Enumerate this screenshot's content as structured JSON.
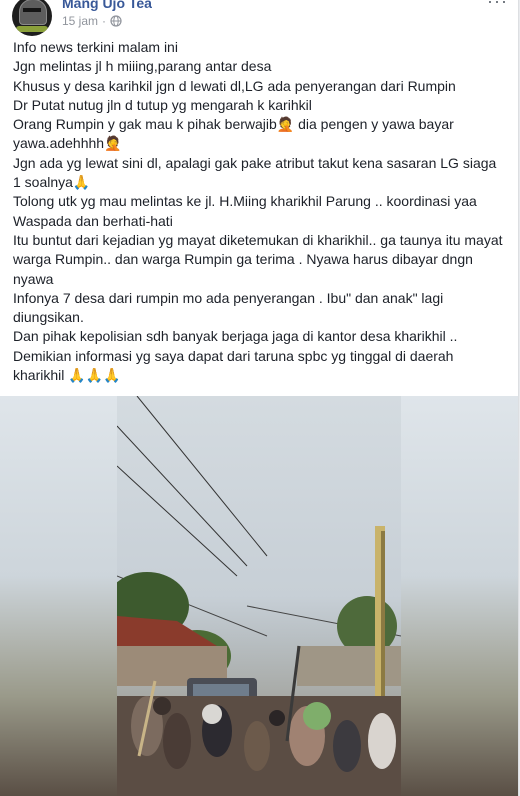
{
  "post": {
    "author": "Mang Ujo Tea",
    "time": "15 jam",
    "separator": "·",
    "privacy_icon": "globe-icon",
    "more_icon": "more-options-icon",
    "more_label": "···",
    "lines": [
      "Info news terkini malam ini",
      "Jgn melintas jl h miiing,parang antar desa",
      "Khusus y desa karihkil jgn d lewati dl,LG ada penyerangan dari Rumpin",
      "Dr Putat nutug jln d tutup yg mengarah k karihkil",
      "Orang Rumpin y gak mau k pihak berwajib🤦 dia pengen y yawa bayar",
      "yawa.adehhhh🤦",
      "Jgn ada yg lewat sini dl, apalagi gak pake atribut takut kena sasaran LG siaga",
      "1 soalnya🙏",
      "Tolong utk yg mau melintas ke jl. H.Miing kharikhil Parung .. koordinasi yaa",
      "Waspada dan berhati-hati",
      "Itu buntut dari kejadian yg mayat diketemukan di kharikhil.. ga taunya itu mayat",
      "warga Rumpin.. dan warga Rumpin ga terima . Nyawa harus dibayar dngn",
      "nyawa",
      "Infonya 7 desa dari rumpin mo ada penyerangan . Ibu\" dan anak\" lagi",
      "diungsikan.",
      "Dan pihak kepolisian sdh banyak berjaga jaga di kantor desa kharikhil ..",
      "Demikian informasi yg saya dapat dari taruna spbc yg tinggal di daerah",
      "kharikhil 🙏🙏🙏"
    ]
  },
  "media": {
    "type": "video",
    "name": "street-crowd-video"
  },
  "colors": {
    "author_link": "#385898",
    "meta_text": "#90949c",
    "body_text": "#1d2129"
  }
}
